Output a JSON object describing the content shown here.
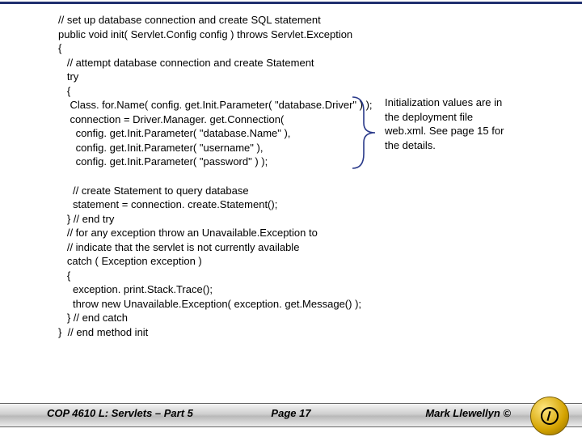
{
  "code": {
    "line1": "// set up database connection and create SQL statement",
    "line2": "public void init( Servlet.Config config ) throws Servlet.Exception",
    "line3": "{",
    "line4": "   // attempt database connection and create Statement",
    "line5": "   try",
    "line6": "   {",
    "line7": "    Class. for.Name( config. get.Init.Parameter( \"database.Driver\" ) );",
    "line8": "    connection = Driver.Manager. get.Connection(",
    "line9": "      config. get.Init.Parameter( \"database.Name\" ),",
    "line10": "      config. get.Init.Parameter( \"username\" ),",
    "line11": "      config. get.Init.Parameter( \"password\" ) );",
    "line12": "",
    "line13": "     // create Statement to query database",
    "line14": "     statement = connection. create.Statement();",
    "line15": "   } // end try",
    "line16": "   // for any exception throw an Unavailable.Exception to",
    "line17": "   // indicate that the servlet is not currently available",
    "line18": "   catch ( Exception exception )",
    "line19": "   {",
    "line20": "     exception. print.Stack.Trace();",
    "line21": "     throw new Unavailable.Exception( exception. get.Message() );",
    "line22": "   } // end catch",
    "line23": "}  // end method init"
  },
  "callout": {
    "text": "Initialization values are in the deployment file web.xml. See page 15 for the details."
  },
  "footer": {
    "left": "COP 4610 L: Servlets – Part 5",
    "center": "Page 17",
    "right": "Mark Llewellyn ©"
  }
}
